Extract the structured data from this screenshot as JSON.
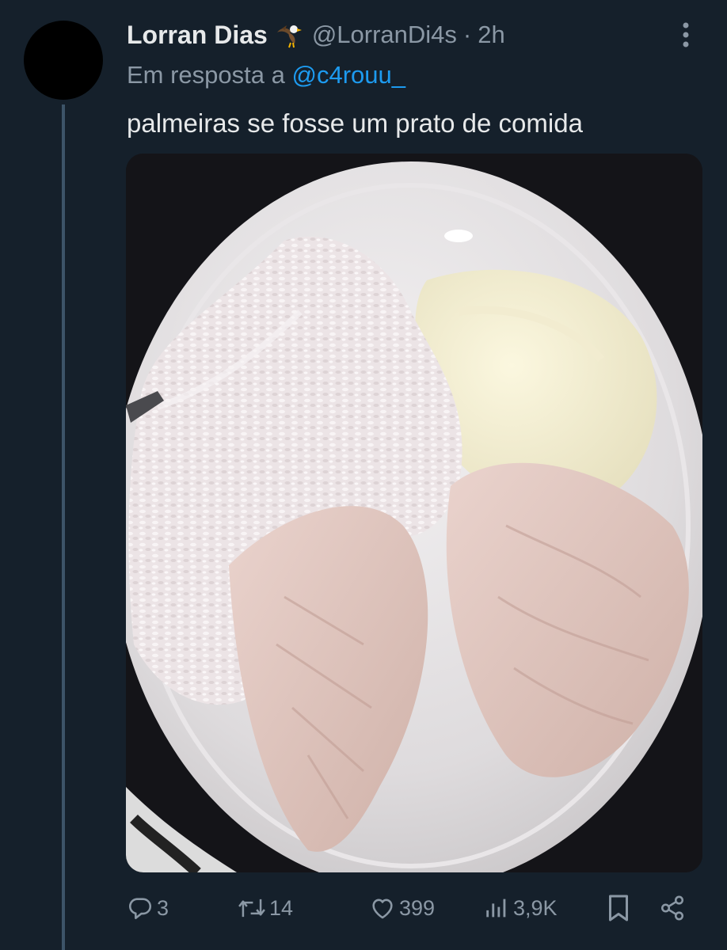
{
  "tweet": {
    "author_name": "Lorran Dias",
    "author_badge_icon": "eagle-emoji-icon",
    "handle": "@LorranDi4s",
    "separator": "·",
    "timestamp": "2h",
    "reply_prefix": "Em resposta a",
    "reply_to_handle": "@c4rouu_",
    "text": "palmeiras se fosse um prato de comida",
    "media_icon": "photo-plate-rice-chicken-mayonnaise"
  },
  "actions": {
    "reply_count": "3",
    "retweet_count": "14",
    "like_count": "399",
    "views_count": "3,9K",
    "icons": [
      "reply-icon",
      "retweet-icon",
      "like-icon",
      "views-icon",
      "bookmark-icon",
      "share-icon"
    ]
  },
  "colors": {
    "background": "#15202b",
    "primary_text": "#e7e9ea",
    "secondary_text": "#8b98a5",
    "link": "#1d9bf0",
    "thread_line": "#3d5468"
  }
}
